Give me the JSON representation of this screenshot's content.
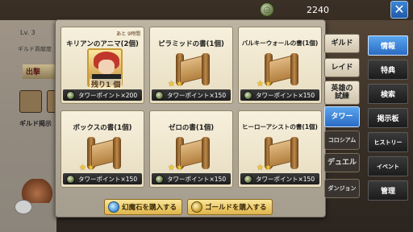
{
  "header": {
    "currency_value": "2240",
    "currency_icon": "tower-point-coin-icon",
    "close_label": "✕"
  },
  "left": {
    "level": "Lv. 3",
    "guild_rank": "ギルド貢献度",
    "sortie": "出撃",
    "guild_label": "ギルド掲示"
  },
  "cards": [
    {
      "title": "キリアンのアニマ(2個)",
      "sub": "あと 9時間",
      "remain": "残り1 個",
      "price": "タワーポイント×200",
      "type": "portrait",
      "stars": 0
    },
    {
      "title": "ピラミッドの書(1個)",
      "price": "タワーポイント×150",
      "type": "scroll",
      "stars": 2
    },
    {
      "title": "バルキーウォールの書(1個)",
      "price": "タワーポイント×150",
      "type": "scroll",
      "stars": 2
    },
    {
      "title": "ボックスの書(1個)",
      "price": "タワーポイント×150",
      "type": "scroll",
      "stars": 2
    },
    {
      "title": "ゼロの書(1個)",
      "price": "タワーポイント×150",
      "type": "scroll",
      "stars": 2
    },
    {
      "title": "ヒーローアシストの書(1個)",
      "price": "タワーポイント×150",
      "type": "scroll",
      "stars": 2
    }
  ],
  "buttons": {
    "buy_gem": "幻魔石を購入する",
    "buy_gold": "ゴールドを購入する"
  },
  "mid_tabs": [
    "ギルド",
    "レイド",
    "英雄の試練",
    "タワー",
    "コロシアム",
    "デュエル",
    "ダンジョン"
  ],
  "side_menu": [
    "情報",
    "特典",
    "検索",
    "掲示板",
    "ヒストリー",
    "イベント",
    "管理"
  ]
}
